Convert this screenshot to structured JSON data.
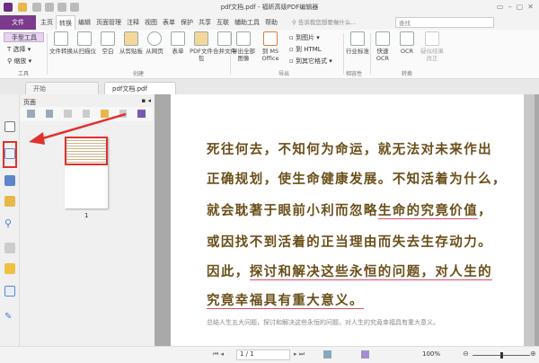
{
  "window": {
    "title": "pdf文档.pdf - 福昕高级PDF编辑器",
    "search_hint": "告诉我您想要做什么...",
    "find_placeholder": "查找"
  },
  "menu": {
    "file": "文件",
    "items": [
      "主页",
      "转换",
      "编辑",
      "页面管理",
      "注释",
      "视图",
      "表单",
      "保护",
      "共享",
      "互联",
      "辅助工具",
      "帮助"
    ],
    "active": "转换"
  },
  "ribbon": {
    "tools": {
      "hand": "手型工具",
      "select": "选择",
      "zoom": "缩放",
      "group": "工具"
    },
    "create": {
      "buttons": [
        "文件转换",
        "从扫描仪",
        "空白",
        "从剪贴板",
        "从网页",
        "表单",
        "PDF文件包",
        "合并文件"
      ],
      "group": "创建"
    },
    "export": {
      "buttons": [
        "导出全部图像",
        "到 MS Office",
        "到图片",
        "到 HTML",
        "到其它格式"
      ],
      "group": "导出"
    },
    "compat": {
      "buttons": [
        "行业标准"
      ],
      "group": "相容性"
    },
    "convert": {
      "buttons": [
        "快速OCR",
        "OCR",
        "疑似结果改正"
      ],
      "group": "转换"
    }
  },
  "tabs": [
    {
      "label": "开始"
    },
    {
      "label": "pdf文档.pdf",
      "active": true
    }
  ],
  "panel": {
    "title": "页面",
    "thumb_label": "1"
  },
  "document": {
    "lines": [
      "死往何去，不知何为命运，就无法对未来作出",
      "正确规划，使生命健康发展。不知活着为什么，",
      "就会耽著于眼前小利而忽略",
      "生命的究竟价值",
      "，",
      "或因找不到活着的正当理由而失去生存动力。",
      "因此，",
      "探讨和解决这些永恒的问题，对人生的",
      "究竟幸福具有重大意义。"
    ],
    "summary": "总结人生五大问题，探讨和解决这些永恒的问题，对人生的究竟幸福具有重大意义。"
  },
  "status": {
    "page": "1 / 1",
    "zoom": "100%",
    "zoom_slider_percent": 50
  },
  "colors": {
    "accent": "#7b3a8c",
    "highlight_box": "#e03030",
    "underline": "#e24a6a",
    "text": "#6b4f1a"
  }
}
